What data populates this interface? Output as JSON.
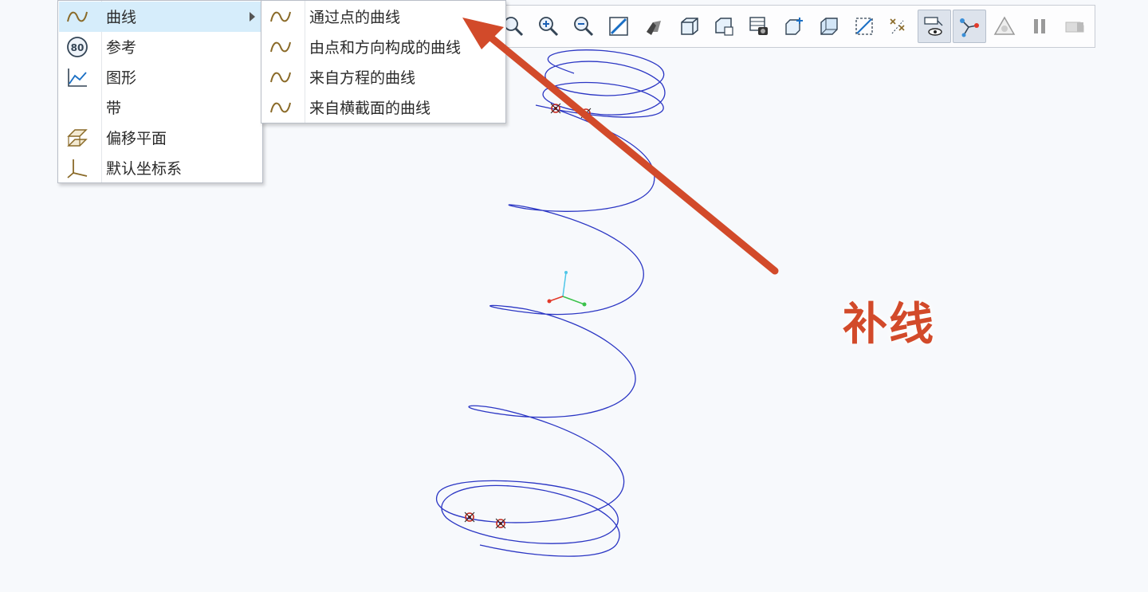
{
  "colors": {
    "background": "#f7f9fc",
    "helix": "#2b36c4",
    "annotation": "#d24a2a",
    "menu_highlight": "#d6edfb",
    "curve_icon": "#8a6a28",
    "point_marker": "#c62a1e"
  },
  "main_menu": {
    "items": [
      {
        "label": "曲线",
        "icon": "curve-icon",
        "selected": true,
        "has_submenu": true
      },
      {
        "label": "参考",
        "icon": "reference-icon",
        "selected": false,
        "has_submenu": false
      },
      {
        "label": "图形",
        "icon": "graph-icon",
        "selected": false,
        "has_submenu": false
      },
      {
        "label": "带",
        "icon": "",
        "selected": false,
        "has_submenu": false
      },
      {
        "label": "偏移平面",
        "icon": "offset-plane-icon",
        "selected": false,
        "has_submenu": false
      },
      {
        "label": "默认坐标系",
        "icon": "coordinate-system-icon",
        "selected": false,
        "has_submenu": false
      }
    ]
  },
  "sub_menu": {
    "items": [
      {
        "label": "通过点的曲线",
        "icon": "curve-icon"
      },
      {
        "label": "由点和方向构成的曲线",
        "icon": "curve-icon"
      },
      {
        "label": "来自方程的曲线",
        "icon": "curve-icon"
      },
      {
        "label": "来自横截面的曲线",
        "icon": "curve-icon"
      }
    ]
  },
  "toolbar": {
    "buttons": [
      {
        "icon": "zoom-to-fit-icon",
        "active": false
      },
      {
        "icon": "zoom-in-icon",
        "active": false
      },
      {
        "icon": "zoom-out-icon",
        "active": false
      },
      {
        "icon": "repaint-icon",
        "active": false
      },
      {
        "icon": "display-style-icon",
        "active": false
      },
      {
        "icon": "saved-orientations-icon",
        "active": false
      },
      {
        "icon": "view-manager-icon",
        "active": false
      },
      {
        "icon": "perspective-icon",
        "active": false
      },
      {
        "icon": "spin-center-icon",
        "active": false
      },
      {
        "icon": "section-icon",
        "active": false
      },
      {
        "icon": "plane-display-icon",
        "active": false
      },
      {
        "icon": "point-display-icon",
        "active": false
      },
      {
        "icon": "annotation-display-icon",
        "active": true
      },
      {
        "icon": "datum-display-icon",
        "active": true
      },
      {
        "icon": "simulation-icon",
        "active": false
      },
      {
        "icon": "pause-icon",
        "active": false
      },
      {
        "icon": "dim-display-icon",
        "active": false
      }
    ]
  },
  "annotation": {
    "text": "补线"
  }
}
